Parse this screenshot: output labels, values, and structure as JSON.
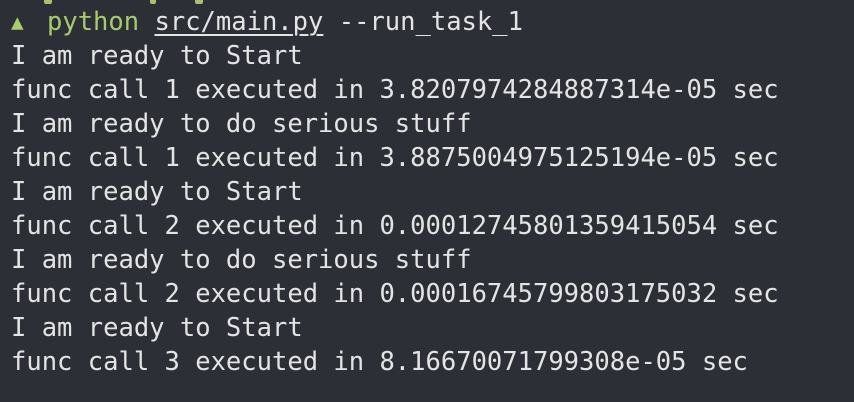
{
  "prompt": {
    "symbol": "▲",
    "command": "python",
    "file_arg": "src/main.py",
    "flag_arg": "--run_task_1"
  },
  "output": [
    "I am ready to Start",
    "func call 1 executed in 3.8207974284887314e-05 sec",
    "I am ready to do serious stuff",
    "func call 1 executed in 3.8875004975125194e-05 sec",
    "I am ready to Start",
    "func call 2 executed in 0.00012745801359415054 sec",
    "I am ready to do serious stuff",
    "func call 2 executed in 0.00016745799803175032 sec",
    "I am ready to Start",
    "func call 3 executed in 8.16670071799308e-05 sec"
  ],
  "colors": {
    "background": "#2c2f35",
    "prompt_green": "#a8cc6c",
    "text": "#e4e4e4"
  }
}
